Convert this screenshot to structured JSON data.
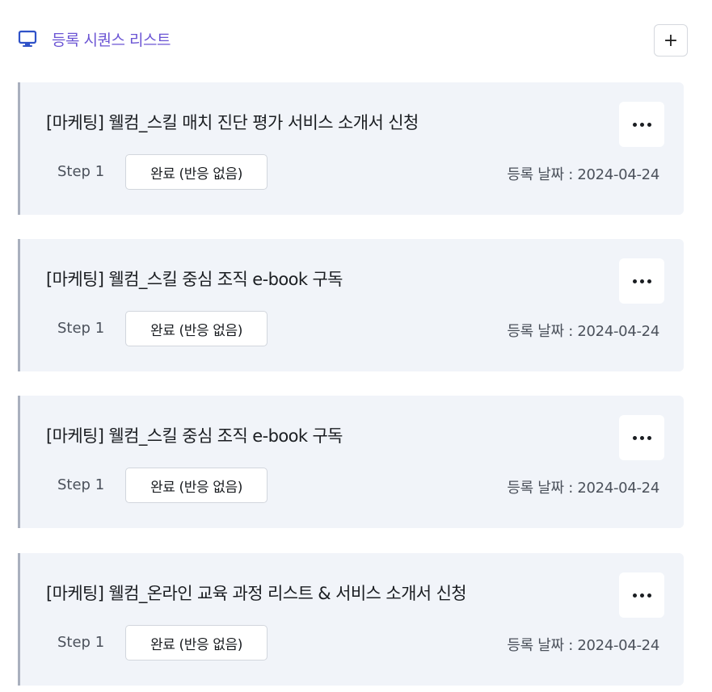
{
  "header": {
    "title": "등록 시퀀스 리스트",
    "add_label": "+",
    "accent_color": "#6b55d4"
  },
  "sequences": [
    {
      "title": "[마케팅] 웰컴_스킬 매치 진단 평가 서비스 소개서 신청",
      "step": "Step 1",
      "status": "완료 (반응 없음)",
      "date": "등록 날짜 : 2024-04-24"
    },
    {
      "title": "[마케팅] 웰컴_스킬 중심 조직 e-book 구독",
      "step": "Step 1",
      "status": "완료 (반응 없음)",
      "date": "등록 날짜 : 2024-04-24"
    },
    {
      "title": "[마케팅] 웰컴_스킬 중심 조직 e-book 구독",
      "step": "Step 1",
      "status": "완료 (반응 없음)",
      "date": "등록 날짜 : 2024-04-24"
    },
    {
      "title": "[마케팅] 웰컴_온라인 교육 과정 리스트 & 서비스 소개서 신청",
      "step": "Step 1",
      "status": "완료 (반응 없음)",
      "date": "등록 날짜 : 2024-04-24"
    }
  ],
  "icons": {
    "header_icon": "monitor-icon",
    "card_menu_icon": "more-horizontal-icon"
  }
}
